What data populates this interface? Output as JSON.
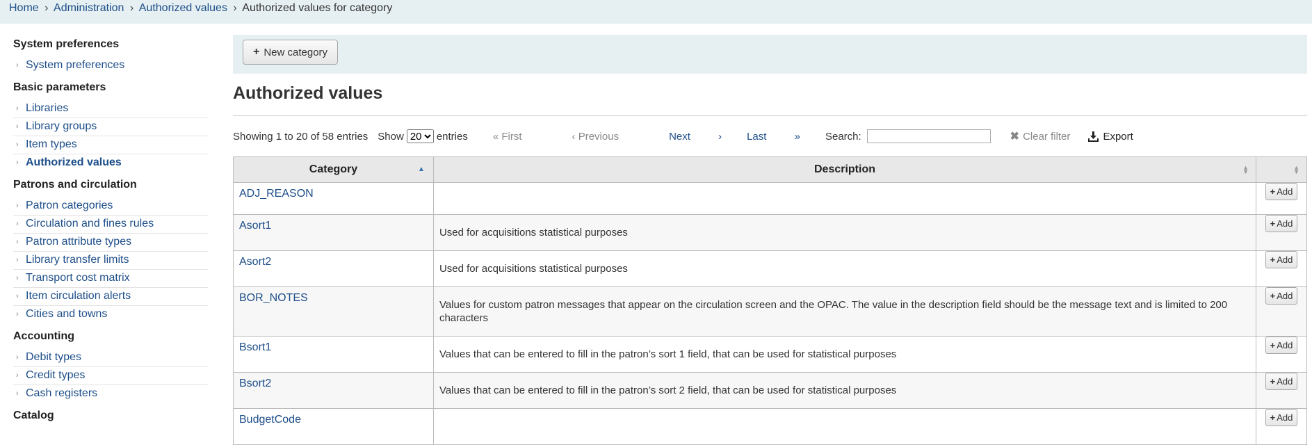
{
  "breadcrumb": {
    "items": [
      "Home",
      "Administration",
      "Authorized values"
    ],
    "current": "Authorized values for category",
    "separator": "›"
  },
  "sidebar": {
    "sections": [
      {
        "title": "System preferences",
        "items": [
          "System preferences"
        ]
      },
      {
        "title": "Basic parameters",
        "items": [
          "Libraries",
          "Library groups",
          "Item types",
          "Authorized values"
        ]
      },
      {
        "title": "Patrons and circulation",
        "items": [
          "Patron categories",
          "Circulation and fines rules",
          "Patron attribute types",
          "Library transfer limits",
          "Transport cost matrix",
          "Item circulation alerts",
          "Cities and towns"
        ]
      },
      {
        "title": "Accounting",
        "items": [
          "Debit types",
          "Credit types",
          "Cash registers"
        ]
      },
      {
        "title": "Catalog",
        "items": []
      }
    ],
    "current_item": "Authorized values"
  },
  "toolbar": {
    "new_category_label": "New category",
    "new_category_icon": "plus-icon"
  },
  "page_title": "Authorized values",
  "table_controls": {
    "info": "Showing 1 to 20 of 58 entries",
    "show_label": "Show",
    "page_size": "20",
    "entries_label": "entries",
    "first": "First",
    "previous": "Previous",
    "next": "Next",
    "last": "Last",
    "search_label": "Search:",
    "search_value": "",
    "clear_filter": "Clear filter",
    "export": "Export"
  },
  "table": {
    "headers": [
      "Category",
      "Description",
      ""
    ],
    "sorted_column": "Category",
    "add_label": "Add",
    "rows": [
      {
        "category": "ADJ_REASON",
        "description": ""
      },
      {
        "category": "Asort1",
        "description": "Used for acquisitions statistical purposes"
      },
      {
        "category": "Asort2",
        "description": "Used for acquisitions statistical purposes"
      },
      {
        "category": "BOR_NOTES",
        "description": "Values for custom patron messages that appear on the circulation screen and the OPAC. The value in the description field should be the message text and is limited to 200 characters"
      },
      {
        "category": "Bsort1",
        "description": "Values that can be entered to fill in the patron’s sort 1 field, that can be used for statistical purposes"
      },
      {
        "category": "Bsort2",
        "description": "Values that can be entered to fill in the patron’s sort 2 field, that can be used for statistical purposes"
      },
      {
        "category": "BudgetCode",
        "description": ""
      }
    ]
  },
  "colors": {
    "link": "#1d4e89",
    "header_bg": "#e6f0f2",
    "table_header_bg": "#e8e8e8"
  }
}
